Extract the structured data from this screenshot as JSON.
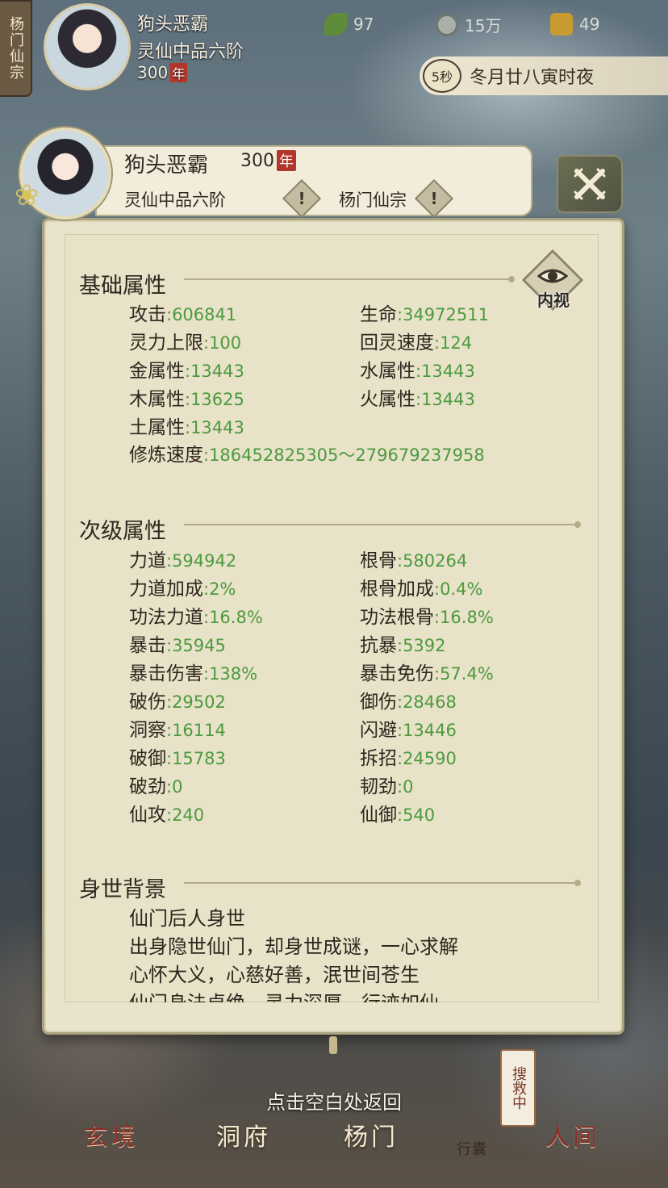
{
  "hud": {
    "sect_tab": "杨门仙宗",
    "name": "狗头恶霸",
    "rank": "灵仙中品六阶",
    "age": "300",
    "age_unit": "年",
    "resources": [
      {
        "icon": "jade-leaf-icon",
        "value": "97"
      },
      {
        "icon": "coin-icon",
        "value": "15万"
      },
      {
        "icon": "strength-icon",
        "value": "49"
      }
    ],
    "timer_label": "5秒",
    "time_text": "冬月廿八寅时夜"
  },
  "panel": {
    "name": "狗头恶霸",
    "age": "300",
    "age_unit": "年",
    "rank": "灵仙中品六阶",
    "sect": "杨门仙宗",
    "info_glyph": "!",
    "eye_label": "内视",
    "basic_title": "基础属性",
    "basic": [
      {
        "label": "攻击",
        "value": ":606841"
      },
      {
        "label": "生命",
        "value": ":34972511"
      },
      {
        "label": "灵力上限",
        "value": ":100"
      },
      {
        "label": "回灵速度",
        "value": ":124"
      },
      {
        "label": "金属性",
        "value": ":13443"
      },
      {
        "label": "水属性",
        "value": ":13443"
      },
      {
        "label": "木属性",
        "value": ":13625"
      },
      {
        "label": "火属性",
        "value": ":13443"
      },
      {
        "label": "土属性",
        "value": ":13443"
      },
      {
        "label": "修炼速度",
        "value": ":186452825305～279679237958"
      }
    ],
    "secondary_title": "次级属性",
    "secondary": [
      {
        "label": "力道",
        "value": ":594942"
      },
      {
        "label": "根骨",
        "value": ":580264"
      },
      {
        "label": "力道加成",
        "value": ":2%"
      },
      {
        "label": "根骨加成",
        "value": ":0.4%"
      },
      {
        "label": "功法力道",
        "value": ":16.8%"
      },
      {
        "label": "功法根骨",
        "value": ":16.8%"
      },
      {
        "label": "暴击",
        "value": ":35945"
      },
      {
        "label": "抗暴",
        "value": ":5392"
      },
      {
        "label": "暴击伤害",
        "value": ":138%"
      },
      {
        "label": "暴击免伤",
        "value": ":57.4%"
      },
      {
        "label": "破伤",
        "value": ":29502"
      },
      {
        "label": "御伤",
        "value": ":28468"
      },
      {
        "label": "洞察",
        "value": ":16114"
      },
      {
        "label": "闪避",
        "value": ":13446"
      },
      {
        "label": "破御",
        "value": ":15783"
      },
      {
        "label": "拆招",
        "value": ":24590"
      },
      {
        "label": "破劲",
        "value": ":0"
      },
      {
        "label": "韧劲",
        "value": ":0"
      },
      {
        "label": "仙攻",
        "value": ":240"
      },
      {
        "label": "仙御",
        "value": ":540"
      }
    ],
    "background_title": "身世背景",
    "background_lines": [
      "仙门后人身世",
      "出身隐世仙门，却身世成谜，一心求解",
      "心怀大义，心慈好善，泯世间苍生",
      "仙门身法卓绝，灵力深厚，行迹如仙"
    ]
  },
  "return_hint": "点击空白处返回",
  "nav": {
    "items": [
      "玄境",
      "洞府",
      "杨门",
      "行囊",
      "人间"
    ],
    "search_seal": "搜救中"
  },
  "colors": {
    "value_green": "#4c9a3e",
    "parchment": "#e8e2c8",
    "age_badge_red": "#b2362b"
  }
}
